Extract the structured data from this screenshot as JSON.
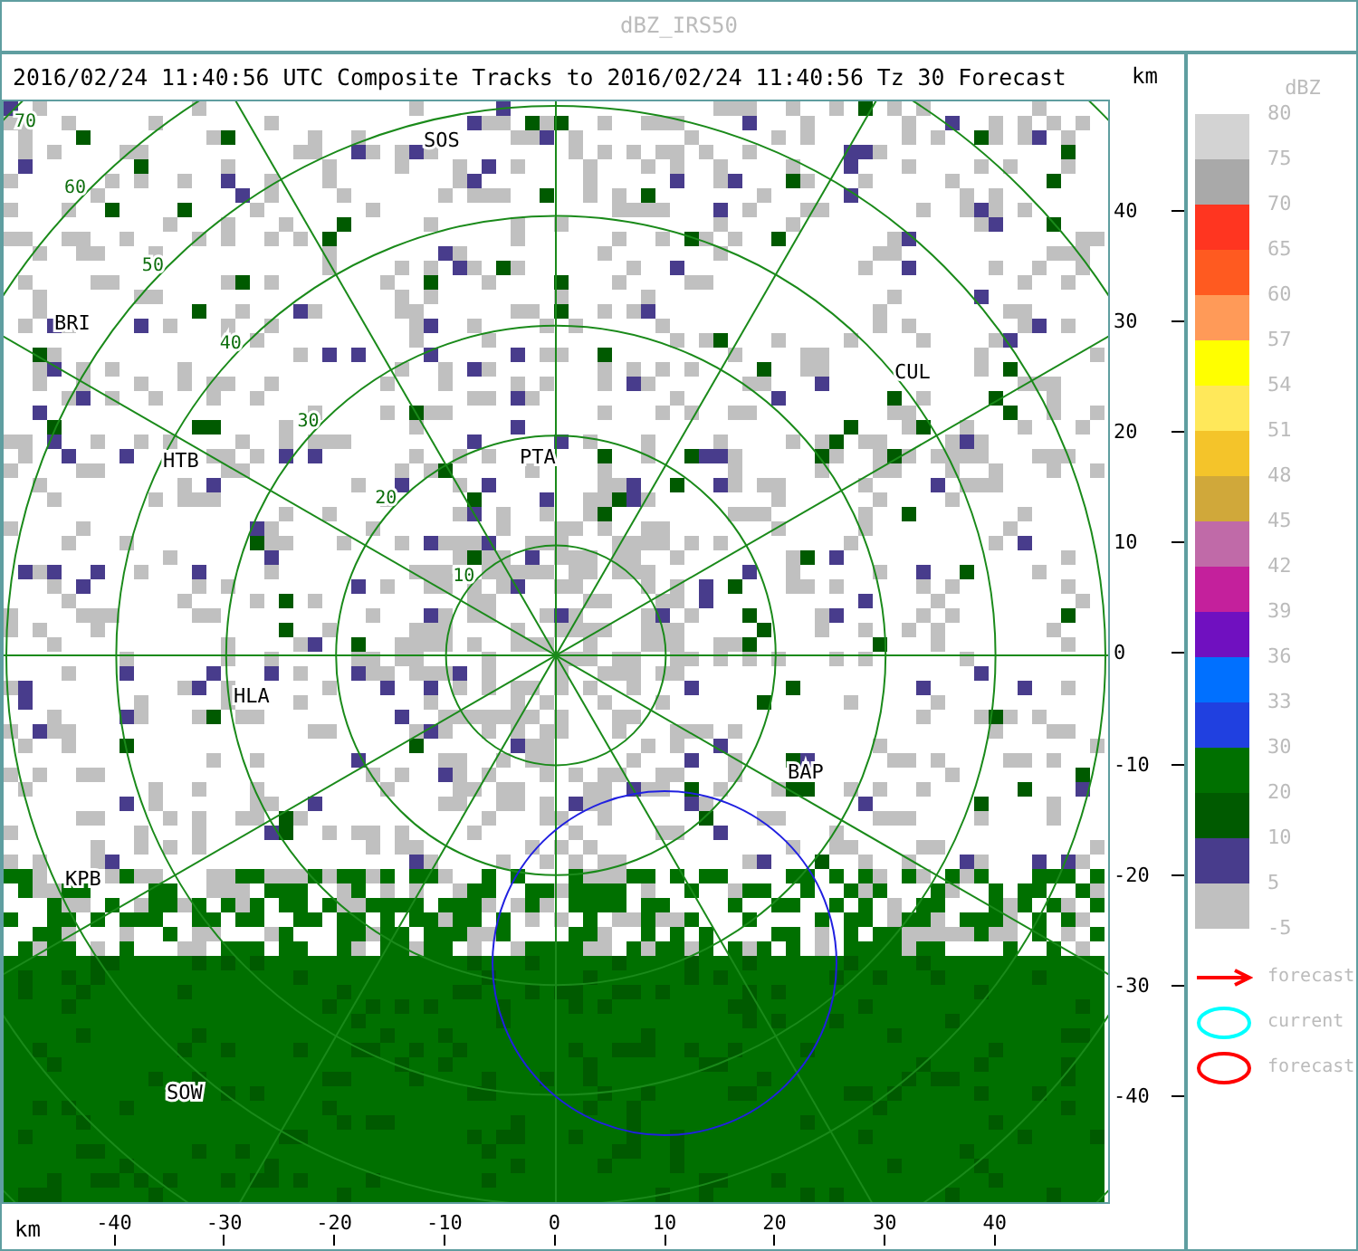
{
  "window": {
    "title": "dBZ_IRS50"
  },
  "header": {
    "title": "2016/02/24 11:40:56 UTC Composite Tracks to 2016/02/24 11:40:56 Tz 30 Forecast"
  },
  "map": {
    "stations": [
      {
        "name": "SOS"
      },
      {
        "name": "BRI"
      },
      {
        "name": "CUL"
      },
      {
        "name": "HTB"
      },
      {
        "name": "PTA"
      },
      {
        "name": "HLA"
      },
      {
        "name": "BAP"
      },
      {
        "name": "KPB"
      },
      {
        "name": "SOW"
      }
    ],
    "rings": [
      {
        "label": "10"
      },
      {
        "label": "20"
      },
      {
        "label": "30"
      },
      {
        "label": "40"
      },
      {
        "label": "50"
      },
      {
        "label": "60"
      },
      {
        "label": "70"
      }
    ]
  },
  "y_axis": {
    "unit": "km",
    "ticks": [
      "40",
      "30",
      "20",
      "10",
      "0",
      "-10",
      "-20",
      "-30",
      "-40"
    ]
  },
  "x_axis": {
    "unit": "km",
    "ticks": [
      "-40",
      "-30",
      "-20",
      "-10",
      "0",
      "10",
      "20",
      "30",
      "40"
    ]
  },
  "legend": {
    "title": "dBZ",
    "bins": [
      {
        "top_label": "80",
        "color": "#d3d3d3"
      },
      {
        "top_label": "75",
        "color": "#a9a9a9"
      },
      {
        "top_label": "70",
        "color": "#ff3520"
      },
      {
        "top_label": "65",
        "color": "#ff5a20"
      },
      {
        "top_label": "60",
        "color": "#ff9a58"
      },
      {
        "top_label": "57",
        "color": "#ffff00"
      },
      {
        "top_label": "54",
        "color": "#ffe85a"
      },
      {
        "top_label": "51",
        "color": "#f4c42a"
      },
      {
        "top_label": "48",
        "color": "#d0a83a"
      },
      {
        "top_label": "45",
        "color": "#c06aa8"
      },
      {
        "top_label": "42",
        "color": "#c4209c"
      },
      {
        "top_label": "39",
        "color": "#7010c0"
      },
      {
        "top_label": "36",
        "color": "#0070ff"
      },
      {
        "top_label": "33",
        "color": "#2040e0"
      },
      {
        "top_label": "30",
        "color": "#007000"
      },
      {
        "top_label": "20",
        "color": "#005a00"
      },
      {
        "top_label": "10",
        "color": "#483c8c"
      },
      {
        "top_label": "5",
        "color": "#c0c0c0"
      }
    ],
    "bottom_label": "-5",
    "symbols": [
      {
        "kind": "arrow",
        "color": "#ff0000",
        "label": "forecast"
      },
      {
        "kind": "ellipse",
        "color": "#00ffff",
        "label": "current"
      },
      {
        "kind": "ellipse",
        "color": "#ff0000",
        "label": "forecast"
      }
    ]
  }
}
